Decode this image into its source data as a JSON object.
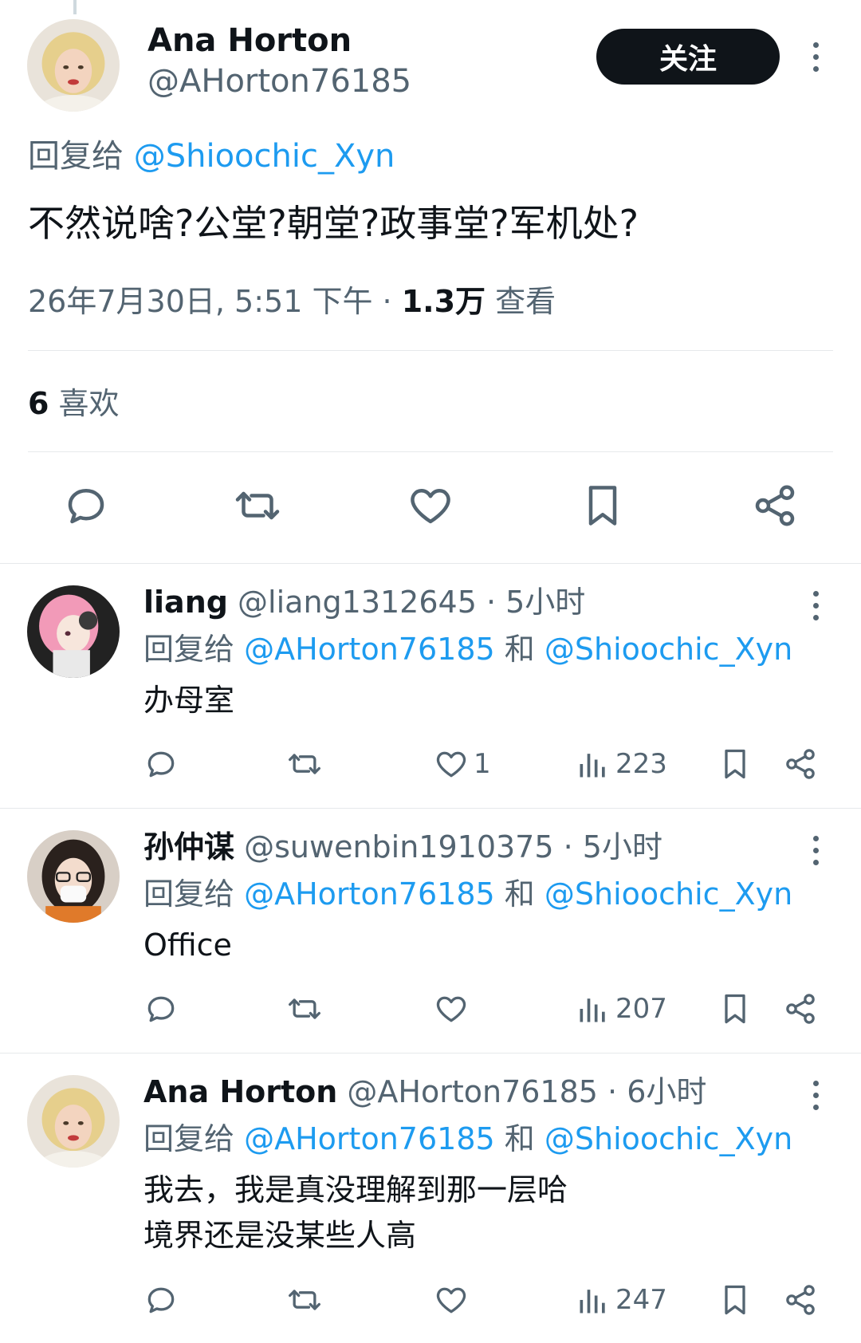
{
  "main_post": {
    "author_name": "Ana Horton",
    "author_handle": "@AHorton76185",
    "follow_label": "关注",
    "reply_prefix": "回复给",
    "reply_to": "@Shioochic_Xyn",
    "text": "不然说啥?公堂?朝堂?政事堂?军机处?",
    "timestamp": "26年7月30日, 5:51 下午 · ",
    "views_count": "1.3万",
    "views_label": "查看",
    "likes_count": "6",
    "likes_label": "喜欢"
  },
  "icons": {
    "reply": "reply-icon",
    "repost": "repost-icon",
    "like": "heart-icon",
    "bookmark": "bookmark-icon",
    "share": "share-icon",
    "views": "views-icon",
    "more": "more-icon"
  },
  "colors": {
    "link": "#1d9bf0",
    "secondary_text": "#536471",
    "primary_text": "#0f1419",
    "follow_bg": "#0f1419"
  },
  "replies": [
    {
      "name": "liang",
      "handle": "@liang1312645",
      "time": " · 5小时",
      "reply_prefix": "回复给",
      "mention1": "@AHorton76185",
      "conj": "和",
      "mention2": "@Shioochic_Xyn",
      "text_lines": [
        "办母室"
      ],
      "likes": "1",
      "views": "223"
    },
    {
      "name": "孙仲谋",
      "handle": "@suwenbin1910375",
      "time": " · 5小时",
      "reply_prefix": "回复给",
      "mention1": "@AHorton76185",
      "conj": "和",
      "mention2": "@Shioochic_Xyn",
      "text_lines": [
        "Office"
      ],
      "likes": "",
      "views": "207"
    },
    {
      "name": "Ana Horton",
      "handle": "@AHorton76185",
      "time": " · 6小时",
      "reply_prefix": "回复给",
      "mention1": "@AHorton76185",
      "conj": "和",
      "mention2": "@Shioochic_Xyn",
      "text_lines": [
        "我去，我是真没理解到那一层哈",
        "境界还是没某些人高"
      ],
      "likes": "",
      "views": "247"
    }
  ]
}
